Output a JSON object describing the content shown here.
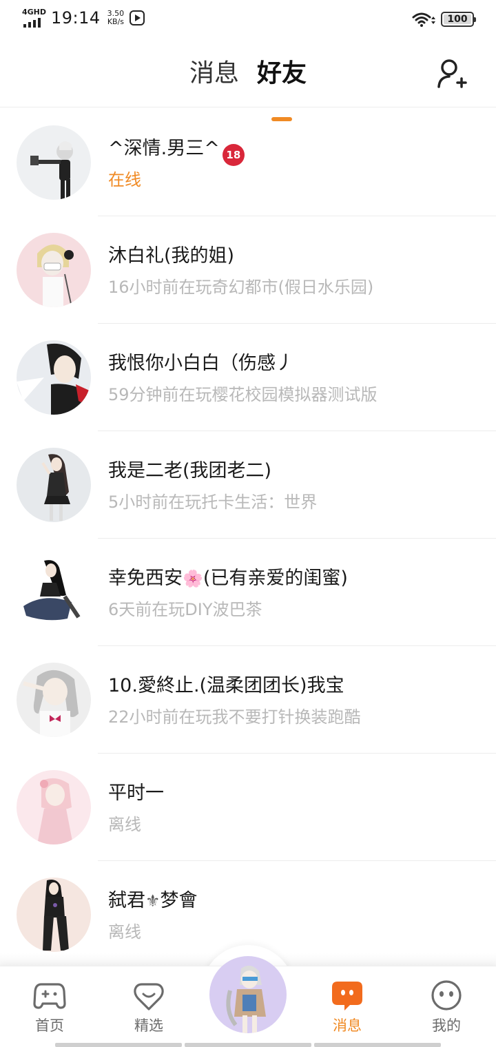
{
  "status_bar": {
    "network": "4GHD",
    "time": "19:14",
    "speed_value": "3.50",
    "speed_unit": "KB/s",
    "battery": "100"
  },
  "header": {
    "tabs": [
      {
        "label": "消息",
        "active": false
      },
      {
        "label": "好友",
        "active": true
      }
    ],
    "add_friend_icon": "add-person-icon"
  },
  "friends": [
    {
      "name": "^深情.男三^",
      "badge": "18",
      "status": "在线",
      "online": true
    },
    {
      "name": "沐白礼(我的姐)",
      "status": "16小时前在玩奇幻都市(假日水乐园)",
      "online": false
    },
    {
      "name": "我恨你小白白（伤感丿",
      "status": "59分钟前在玩樱花校园模拟器测试版",
      "online": false
    },
    {
      "name": "我是二老(我团老二)",
      "status": "5小时前在玩托卡生活：世界",
      "online": false
    },
    {
      "name_before": "幸免西安",
      "flower": "🌸",
      "name_after": "(已有亲爱的闺蜜)",
      "status": "6天前在玩DIY波巴茶",
      "online": false
    },
    {
      "name": "10.愛終止.(温柔团团长)我宝",
      "status": "22小时前在玩我不要打针换装跑酷",
      "online": false
    },
    {
      "name": "平时一",
      "status": "离线",
      "online": false
    },
    {
      "name_before": "弑君",
      "fleur": "⚜",
      "name_after": "梦會",
      "status": "离线",
      "online": false
    }
  ],
  "bottom_nav": {
    "items": [
      {
        "label": "首页",
        "icon": "gamepad-icon",
        "active": false
      },
      {
        "label": "精选",
        "icon": "heart-chat-icon",
        "active": false
      },
      {
        "label": "消息",
        "icon": "message-icon",
        "active": true
      },
      {
        "label": "我的",
        "icon": "face-icon",
        "active": false
      }
    ],
    "center_icon": "character-avatar"
  },
  "colors": {
    "accent": "#f08a24",
    "text_primary": "#1a1a1a",
    "text_secondary": "#b8b8b8",
    "divider": "#ececec"
  }
}
